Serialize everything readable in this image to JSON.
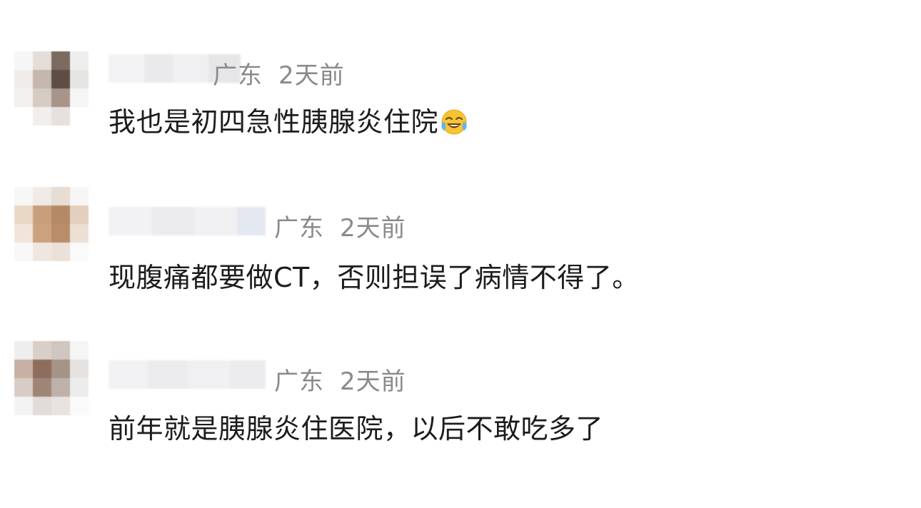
{
  "comments": [
    {
      "location": "广东",
      "time": "2天前",
      "text": "我也是初四急性胰腺炎住院",
      "emoji": "crying-laughing-emoji",
      "avatar_colors": [
        "#f6f6f6",
        "#e4ddd8",
        "#7a6a60",
        "#eeeeee",
        "#efece9",
        "#c5b7ad",
        "#5d4d45",
        "#e7e5e2",
        "#f2f0ee",
        "#d6cbc3",
        "#a89488",
        "#f5f5f5",
        "#ffffff",
        "#f1eeec",
        "#e6e1dd",
        "#ffffff"
      ]
    },
    {
      "location": "广东",
      "time": "2天前",
      "text": "现腹痛都要做CT，否则担误了病情不得了。",
      "emoji": null,
      "avatar_colors": [
        "#f7f7f7",
        "#f0ebe7",
        "#e7ddd4",
        "#f6f6f6",
        "#ead8c6",
        "#c89f7c",
        "#b48a66",
        "#e3cfbd",
        "#f1e5da",
        "#cba27f",
        "#b98d69",
        "#ecdfd3",
        "#f8f8f8",
        "#efe7df",
        "#ebe1d8",
        "#fafafa"
      ]
    },
    {
      "location": "广东",
      "time": "2天前",
      "text": "前年就是胰腺炎住医院，以后不敢吃多了",
      "emoji": null,
      "avatar_colors": [
        "#eeeeee",
        "#d9cfc9",
        "#cfc6bf",
        "#f5f5f5",
        "#c7b1a4",
        "#8e6d5c",
        "#a69388",
        "#e6e2df",
        "#d8cdc6",
        "#9f8576",
        "#bdb1a9",
        "#ececec",
        "#f3f3f3",
        "#e1dcd8",
        "#e6e3e0",
        "#fafafa"
      ]
    }
  ]
}
